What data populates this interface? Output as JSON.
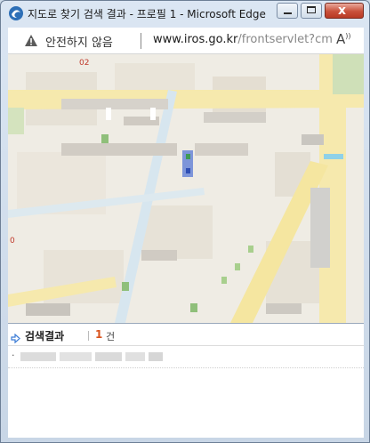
{
  "window": {
    "title": "지도로 찾기 검색 결과 - 프로필 1 - Microsoft Edge",
    "close_symbol": "x"
  },
  "address_bar": {
    "security_label": "안전하지 않음",
    "url_host": "www.iros.go.kr",
    "url_path": "/frontservlet?cm..."
  },
  "icons": {
    "app": "edge-app-icon",
    "warning": "warning-icon",
    "read_aloud": "read-aloud-icon",
    "results_arrow": "arrow-right-icon"
  },
  "results": {
    "title": "검색결과",
    "count": "1",
    "count_unit": "건",
    "items": [
      {
        "bullet": "·"
      }
    ]
  },
  "colors": {
    "count_accent": "#d9541e",
    "map_road": "#f6e7a6",
    "map_marker": "#4a6bd0"
  }
}
